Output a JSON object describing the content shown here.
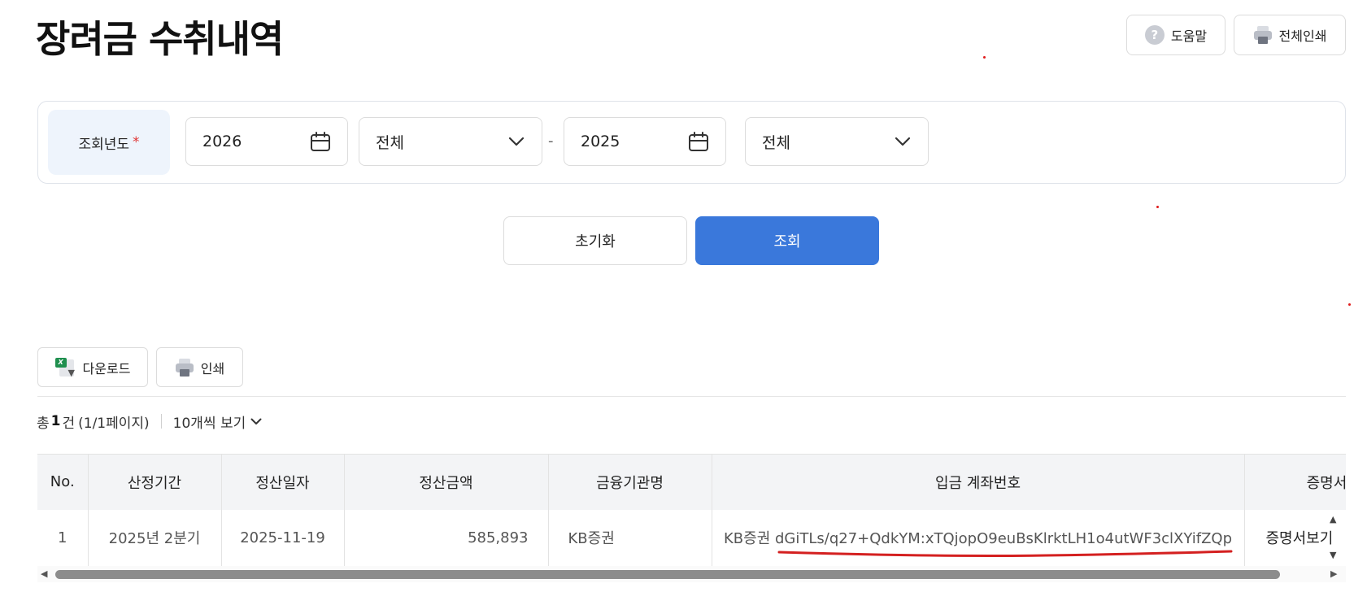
{
  "page": {
    "title": "장려금 수취내역"
  },
  "top_actions": {
    "help_label": "도움말",
    "print_all_label": "전체인쇄"
  },
  "filter": {
    "label": "조회년도",
    "required_mark": "*",
    "from_year": "2026",
    "from_type": "전체",
    "separator": "-",
    "to_year": "2025",
    "to_type": "전체"
  },
  "actions": {
    "reset_label": "초기화",
    "search_label": "조회"
  },
  "list_tools": {
    "download_label": "다운로드",
    "print_label": "인쇄"
  },
  "summary": {
    "prefix": "총",
    "count": "1",
    "unit": "건",
    "pages": "(1/1페이지)",
    "per_page": "10개씩 보기"
  },
  "table": {
    "headers": [
      "No.",
      "산정기간",
      "정산일자",
      "정산금액",
      "금융기관명",
      "입금 계좌번호",
      "증명서보기"
    ],
    "rows": [
      [
        "1",
        "2025년 2분기",
        "2025-11-19",
        "585,893",
        "KB증권",
        "KB증권 dGiTLs/q27+QdkYM:xTQjopO9euBsKlrktLH1o4utWF3clXYifZQp",
        "증명서보기"
      ]
    ]
  },
  "colors": {
    "primary": "#3a78db",
    "required": "#e03434",
    "annotation": "#d42020"
  }
}
